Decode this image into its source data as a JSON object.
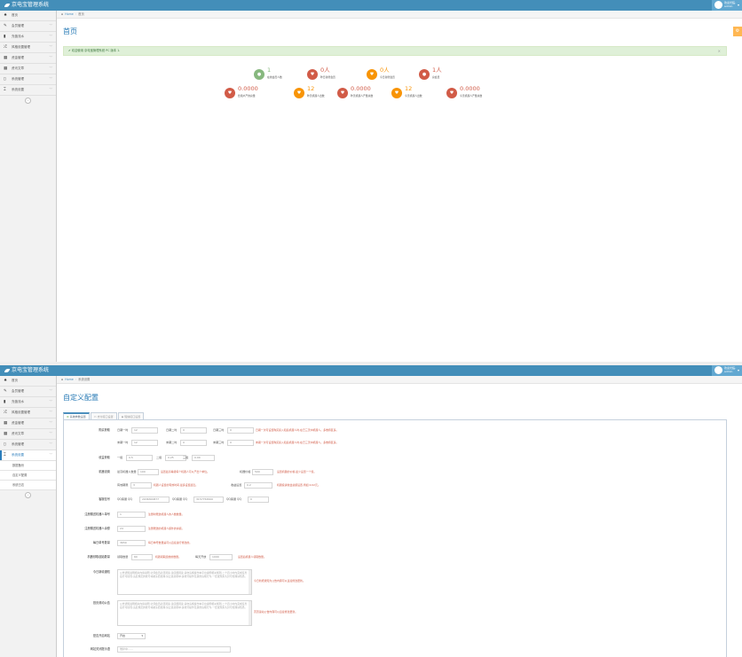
{
  "app": {
    "title": "京电宝管理系统"
  },
  "user": {
    "greeting": "欢迎光临,",
    "name": "admin"
  },
  "sidebar": {
    "items": [
      {
        "label": "首页",
        "icon": "tachometer-icon",
        "glyph": "♠",
        "caret": ""
      },
      {
        "label": "会员管理",
        "icon": "edit-icon",
        "glyph": "✎",
        "caret": "﹀"
      },
      {
        "label": "充值流水",
        "icon": "book-icon",
        "glyph": "▮",
        "caret": "﹀"
      },
      {
        "label": "风格设置管理",
        "icon": "random-icon",
        "glyph": "⤮",
        "caret": "﹀"
      },
      {
        "label": "资金管理",
        "icon": "calendar-icon",
        "glyph": "▦",
        "caret": "﹀"
      },
      {
        "label": "资讯文章",
        "icon": "calendar-icon",
        "glyph": "▦",
        "caret": "﹀"
      },
      {
        "label": "系统管理",
        "icon": "file-icon",
        "glyph": "▯",
        "caret": "﹀"
      },
      {
        "label": "系统设置",
        "icon": "tools-icon",
        "glyph": "⌶",
        "caret": "﹀"
      }
    ],
    "subitems": [
      "数据备份",
      "自定义配置",
      "系统日志"
    ],
    "collapse_glyph": "«"
  },
  "screen1": {
    "breadcrumb": {
      "home": "Home",
      "current": "首页"
    },
    "title": "首页",
    "alert": "✔ 欢迎使用 京电宝管理系统 PC 版本 1.",
    "stats": [
      {
        "color": "green",
        "num": "1",
        "label": "在线会员人数",
        "glyph": "●"
      },
      {
        "color": "red",
        "num": "0人",
        "label": "昨日新增会员",
        "glyph": "♥"
      },
      {
        "color": "orange",
        "num": "0人",
        "label": "今日新增会员",
        "glyph": "♥"
      },
      {
        "color": "red",
        "num": "1人",
        "label": "总会员",
        "glyph": "●"
      },
      {
        "color": "red",
        "num": "0.0000",
        "label": "给用户产的总量",
        "glyph": "♥"
      },
      {
        "color": "orange",
        "num": "12",
        "label": "昨天机器人出数",
        "glyph": "♥"
      },
      {
        "color": "red",
        "num": "0.0000",
        "label": "昨天机器人产量总数",
        "glyph": "♥"
      },
      {
        "color": "orange",
        "num": "12",
        "label": "今天机器人出数",
        "glyph": "♥"
      },
      {
        "color": "red",
        "num": "0.0000",
        "label": "今天机器人产量总数",
        "glyph": "♥"
      }
    ]
  },
  "screen2": {
    "breadcrumb": {
      "home": "Home",
      "current": "系统设置"
    },
    "title": "自定义配置",
    "tabs": [
      "系统参数设置",
      "支付接口设置",
      "短信接口设置"
    ],
    "form": {
      "r1": {
        "label": "购买获取",
        "f1l": "日期一时",
        "f1v": "12",
        "f2l": "日期二时",
        "f2v": "0",
        "f3l": "日期三时",
        "f3v": "0",
        "hint": "日期一次可设置购买投入和后机器人时,在已三天中机器人。多维持区多。"
      },
      "r2": {
        "f1l": "末期一时",
        "f1v": "12",
        "f2l": "末期二时",
        "f2v": "0",
        "f3l": "末期三时",
        "f3v": "0",
        "hint": "末期一次可设置购买投入和后机器人时,在已三天中机器人。多维持区多。"
      },
      "r3": {
        "label": "收益获取",
        "f1l": "一级",
        "f1v": "0.5",
        "f2l": "二级",
        "f2v": "0.25",
        "f3l": "三级",
        "f3v": "0.00"
      },
      "r4": {
        "label": "机器设置",
        "f1l": "最高机器人数量",
        "f1v": "100",
        "hint1": "设置最高等级每个机器人可以产出个单位。",
        "f2l": "机器价格",
        "f2v": "500",
        "hint2": "设置机器的价格,最少设置一个值。"
      },
      "r5": {
        "f1l": "有效期限",
        "f1v": "3",
        "hint1": "机器人设置的有效时间,最多设置最近。",
        "f2l": "收益设置",
        "f2v": "0.2",
        "hint2": "机器投资收益总额设置,例如:0.02元。"
      },
      "r6": {
        "label": "客服信号",
        "f1l": "QQ客服 QQ",
        "f1v": "2936300877",
        "f2l": "QQ客服 QQ",
        "f2v": "3157756500",
        "f3l": "QQ客服 QQ",
        "f3v": "0"
      },
      "r7": {
        "label": "注册赠送机器人单号",
        "v": "1",
        "hint": "注册时赠送机器人的人数数量。"
      },
      "r8": {
        "label": "注册赠送机器人余额",
        "v": "24",
        "hint": "注册赠送的机器人额外的余额。"
      },
      "r9": {
        "label": "每日单号数量",
        "v": "3650",
        "hint": "每日单号数量是可以直接进行修改的。"
      },
      "r10": {
        "label": "机器领取起始数量",
        "f1l": "领取数量",
        "f1v": "60",
        "hint1": "机器领取起始的数量。",
        "f2l": "每天开放",
        "f2v": "1000",
        "hint2": "设置后机器人领取数量。"
      },
      "r11": {
        "label": "今日新增通知",
        "text": "公告通知说明相关内容说明,全部会员必须阅读,请仔细阅读,请勿违规操作本平台说明相关规则,二十四小时内完成任务后方可提现,违反规定的账号将被冻结处理,禁止恶意刷单,多账号操作及其他违规行为,一经发现永久封号处理请知悉。",
        "hint": "今日新增通知为公告内容可以直接修改更新。"
      },
      "r12": {
        "label": "首页滚动公告",
        "text": "公告通知说明相关内容说明,全部会员必须阅读,请仔细阅读,请勿违规操作本平台说明相关规则,二十四小时内完成任务后方可提现,违反规定的账号将被冻结处理,禁止恶意刷单,多账号操作及其他违规行为,一经发现永久封号处理请知悉。",
        "hint": "首页滚动公告内容可以直接修改更新。"
      },
      "r13": {
        "label": "是否开启网站",
        "v": "开启"
      },
      "r14": {
        "label": "网站关闭提示语",
        "placeholder": "维护中……"
      }
    }
  },
  "colors": {
    "topbar": "#438eb9",
    "accent": "#2679b5",
    "hint": "#d15b47",
    "green": "#87b87f",
    "orange": "#f89406"
  }
}
